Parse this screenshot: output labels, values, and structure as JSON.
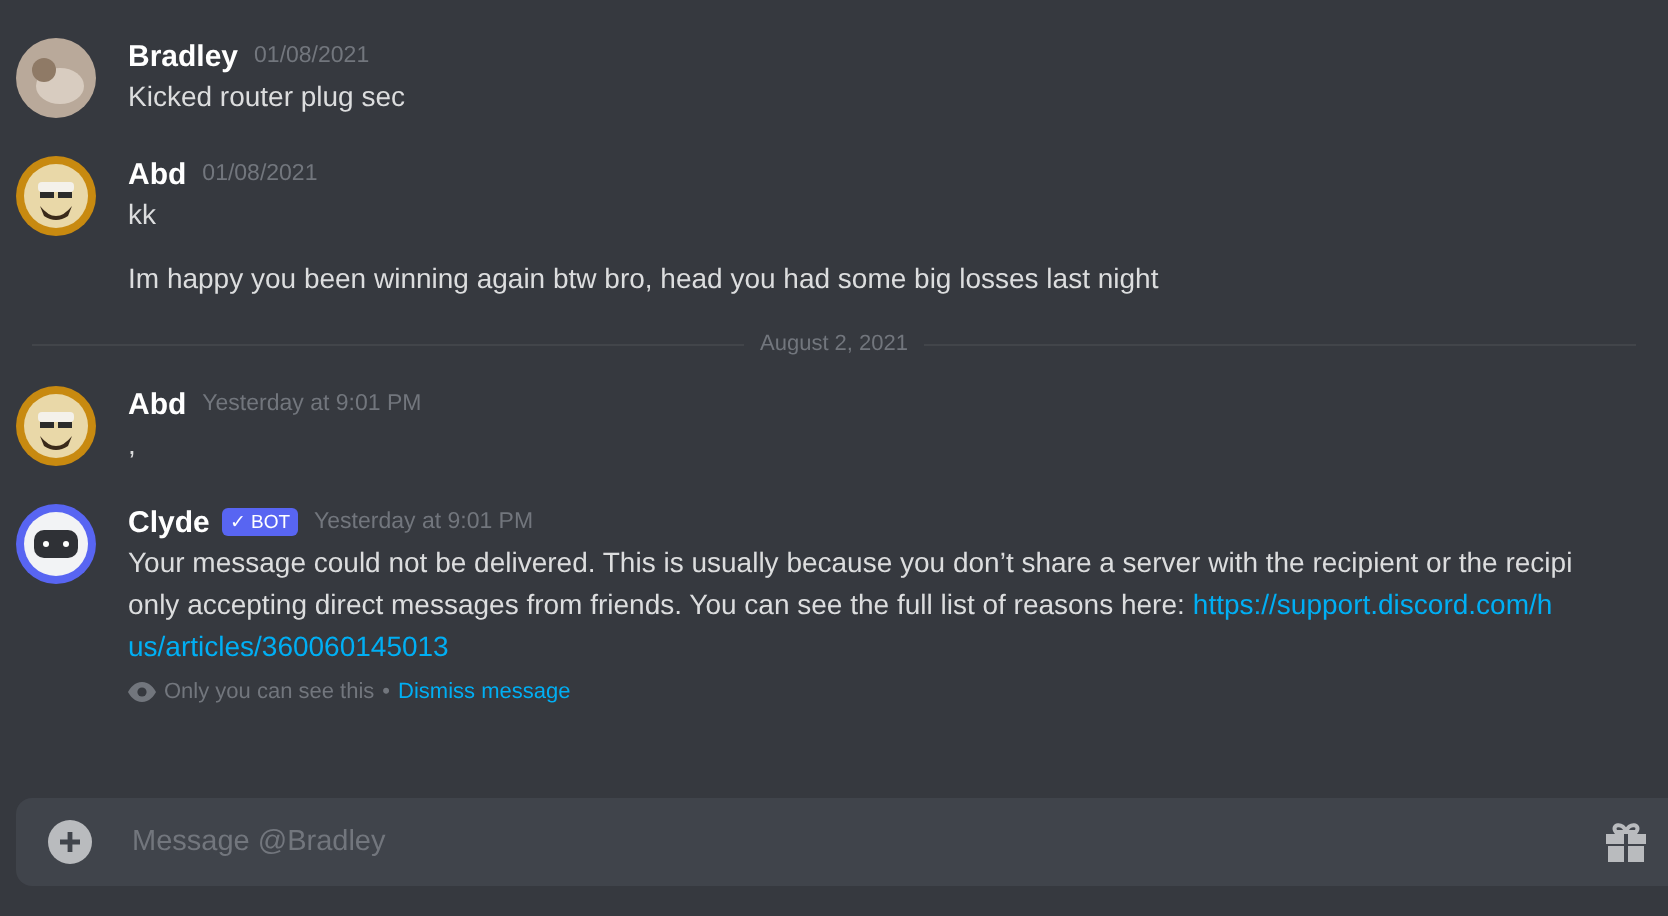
{
  "messages": [
    {
      "kind": "message",
      "author": "Bradley",
      "timestamp": "01/08/2021",
      "avatar": {
        "kind": "photo"
      },
      "bot": false,
      "lines": [
        {
          "text": "Kicked router plug sec"
        }
      ]
    },
    {
      "kind": "message",
      "author": "Abd",
      "timestamp": "01/08/2021",
      "avatar": {
        "kind": "cartoon"
      },
      "bot": false,
      "lines": [
        {
          "text": "kk"
        },
        {
          "text": "Im happy you been winning again btw bro, head you had some big losses last night"
        }
      ]
    },
    {
      "kind": "divider",
      "text": "August 2, 2021"
    },
    {
      "kind": "message",
      "author": "Abd",
      "timestamp": "Yesterday at 9:01 PM",
      "avatar": {
        "kind": "cartoon"
      },
      "bot": false,
      "lines": [
        {
          "text": ","
        }
      ]
    },
    {
      "kind": "message",
      "author": "Clyde",
      "timestamp": "Yesterday at 9:01 PM",
      "avatar": {
        "kind": "robot"
      },
      "bot": true,
      "badge": "✓ BOT",
      "lines": [
        {
          "text": "Your message could not be delivered. This is usually because you don’t share a server with the recipient or the recipi"
        },
        {
          "text": "only accepting direct messages from friends. You can see the full list of reasons here:",
          "link": "https://support.discord.com/h"
        },
        {
          "link": "us/articles/360060145013"
        }
      ],
      "ephemeral": {
        "note": "Only you can see this",
        "separator": "•",
        "action": "Dismiss message"
      }
    }
  ],
  "composer": {
    "placeholder": "Message @Bradley"
  }
}
